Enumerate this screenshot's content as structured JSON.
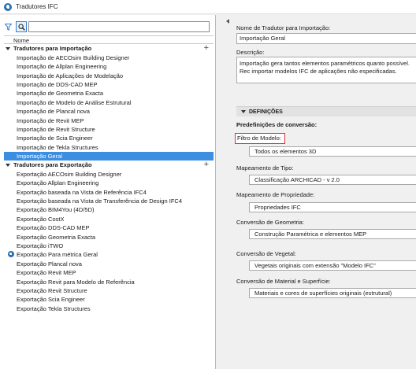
{
  "window": {
    "title": "Tradutores IFC"
  },
  "search": {
    "value": "",
    "placeholder": ""
  },
  "list": {
    "header": "Nome",
    "groups": [
      {
        "label": "Tradutores para Importação",
        "add_label": "+",
        "items": [
          "Importação de AECOsim Building Designer",
          "Importação de Allplan Engineering",
          "Importação de Aplicações de Modelação",
          "Importação de DDS-CAD MEP",
          "Importação de Geometria Exacta",
          "Importação de Modelo de Análise Estrutural",
          "Importação de Plancal nova",
          "Importação de Revit MEP",
          "Importação de Revit Structure",
          "Importação de Scia Engineer",
          "Importação de Tekla Structures",
          "Importação Geral"
        ],
        "selected": "Importação Geral"
      },
      {
        "label": "Tradutores para Exportação",
        "add_label": "+",
        "items": [
          "Exportação AECOsim Building Designer",
          "Exportação Allplan Engineering",
          "Exportação baseada na Vista de Referência IFC4",
          "Exportação baseada na Vista de Transferência de Design IFC4",
          "Exportação BIM4You (4D/5D)",
          "Exportação CostX",
          "Exportação DDS-CAD MEP",
          "Exportação Geometria Exacta",
          "Exportação iTWO",
          "Exportação Para métrica Geral",
          "Exportação Plancal nova",
          "Exportação Revit MEP",
          "Exportação Revit para Modelo de Referência",
          "Exportação Revit Structure",
          "Exportação Scia Engineer",
          "Exportação Tekla Structures"
        ]
      }
    ]
  },
  "details": {
    "name_label": "Nome de Tradutor para Importação:",
    "name_value": "Importação Geral",
    "desc_label": "Descrição:",
    "desc_value": "Importação gera tantos elementos paramétricos quanto possível. Rec importar modelos IFC de aplicações não especificadas.",
    "section_title": "DEFINIÇÕES",
    "predef_label": "Predefinições de conversão:",
    "settings": [
      {
        "label": "Filtro de Modelo:",
        "value": "Todos os elementos 3D"
      },
      {
        "label": "Mapeamento de Tipo:",
        "value": "Classificação ARCHICAD - v 2.0"
      },
      {
        "label": "Mapeamento de Propriedade:",
        "value": "Propriedades IFC"
      },
      {
        "label": "Conversão de Geometria:",
        "value": "Construção Paramétrica e elementos MEP"
      },
      {
        "label": "Conversão de Vegetal:",
        "value": "Vegetais originais com extensão \"Modelo IFC\""
      },
      {
        "label": "Conversão de Material e Superfície:",
        "value": "Materiais e cores de superfícies originais (estrutural)"
      }
    ]
  },
  "colors": {
    "selection": "#3c8ee0",
    "highlight_border": "#e23030",
    "accent": "#2f7ed8"
  },
  "icons": {
    "app": "ifc-logo-icon",
    "filter": "filter-icon",
    "search": "search-icon",
    "collapse": "triangle-down-icon",
    "add": "plus-icon"
  }
}
